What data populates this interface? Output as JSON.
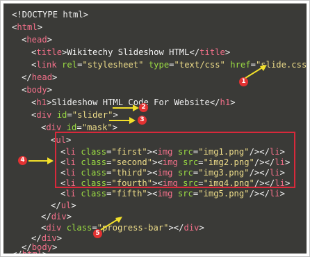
{
  "code": {
    "doctype": "<!DOCTYPE html>",
    "html_tag": "html",
    "head_tag": "head",
    "title_tag": "title",
    "title_text": "Wikitechy Slideshow HTML",
    "link_tag": "link",
    "link_rel_attr": "rel",
    "link_rel_val": "\"stylesheet\"",
    "link_type_attr": "type",
    "link_type_val": "\"text/css\"",
    "link_href_attr": "href",
    "link_href_val": "\"slide.css\"",
    "body_tag": "body",
    "h1_tag": "h1",
    "h1_text": "Slideshow HTML Code For Website",
    "div_tag": "div",
    "id_attr": "id",
    "slider_val": "\"slider\"",
    "mask_val": "\"mask\"",
    "ul_tag": "ul",
    "li_tag": "li",
    "class_attr": "class",
    "img_tag": "img",
    "src_attr": "src",
    "items": [
      {
        "cls": "\"first\"",
        "src": "\"img1.png\""
      },
      {
        "cls": "\"second\"",
        "src": "\"img2.png\""
      },
      {
        "cls": "\"third\"",
        "src": "\"img3.png\""
      },
      {
        "cls": "\"fourth\"",
        "src": "\"img4.png\""
      },
      {
        "cls": "\"fifth\"",
        "src": "\"img5.png\""
      }
    ],
    "progress_val": "\"progress-bar\""
  },
  "callouts": [
    "1",
    "2",
    "3",
    "4",
    "5"
  ],
  "colors": {
    "background": "#3a3a37",
    "tag": "#f3708a",
    "attribute": "#9bdc43",
    "string": "#eddc89",
    "text": "#f3f3f3",
    "callout": "#e33232",
    "arrow": "#f2e02a",
    "highlight_box": "#d8293b"
  }
}
